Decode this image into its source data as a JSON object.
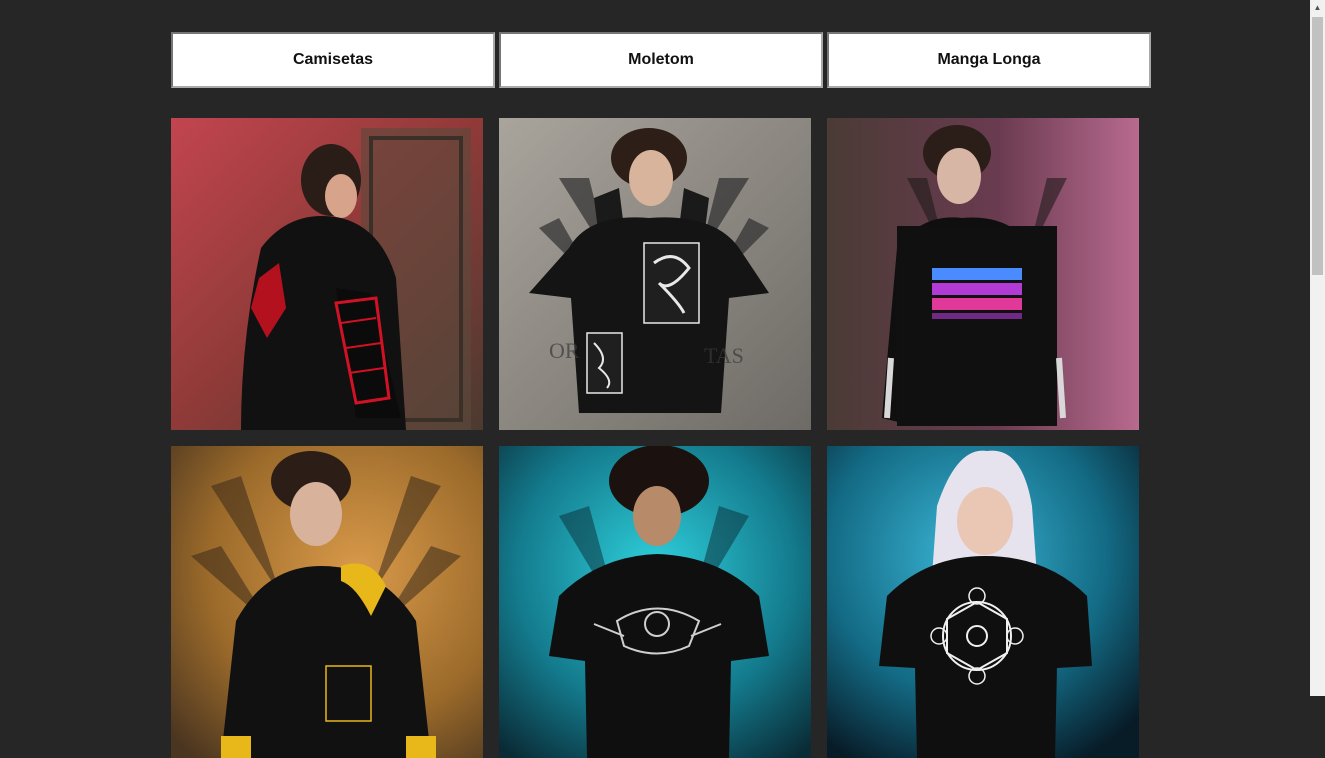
{
  "filters": [
    {
      "label": "Camisetas"
    },
    {
      "label": "Moletom"
    },
    {
      "label": "Manga Longa"
    }
  ],
  "products": [
    {
      "alt": "Moletom preto com estampa vermelha",
      "bg": "#8a2b32",
      "accent": "#d01224"
    },
    {
      "alt": "Moletom preto com patches brancos",
      "bg": "#8c8a85",
      "accent": "#e8e8e8"
    },
    {
      "alt": "Moletom preto com estampa roxa e rosa",
      "bg": "#6b3a5a",
      "accent": "#b23bd6"
    },
    {
      "alt": "Moletom preto com amarelo",
      "bg": "#a86a2a",
      "accent": "#e8b81a"
    },
    {
      "alt": "Camiseta preta com estampa prata",
      "bg": "#1a9aa6",
      "accent": "#cfcfcf"
    },
    {
      "alt": "Camiseta preta com mandala branca",
      "bg": "#137a8c",
      "accent": "#f0f0f0"
    }
  ],
  "colors": {
    "page_background": "#262626",
    "button_background": "#ffffff"
  }
}
